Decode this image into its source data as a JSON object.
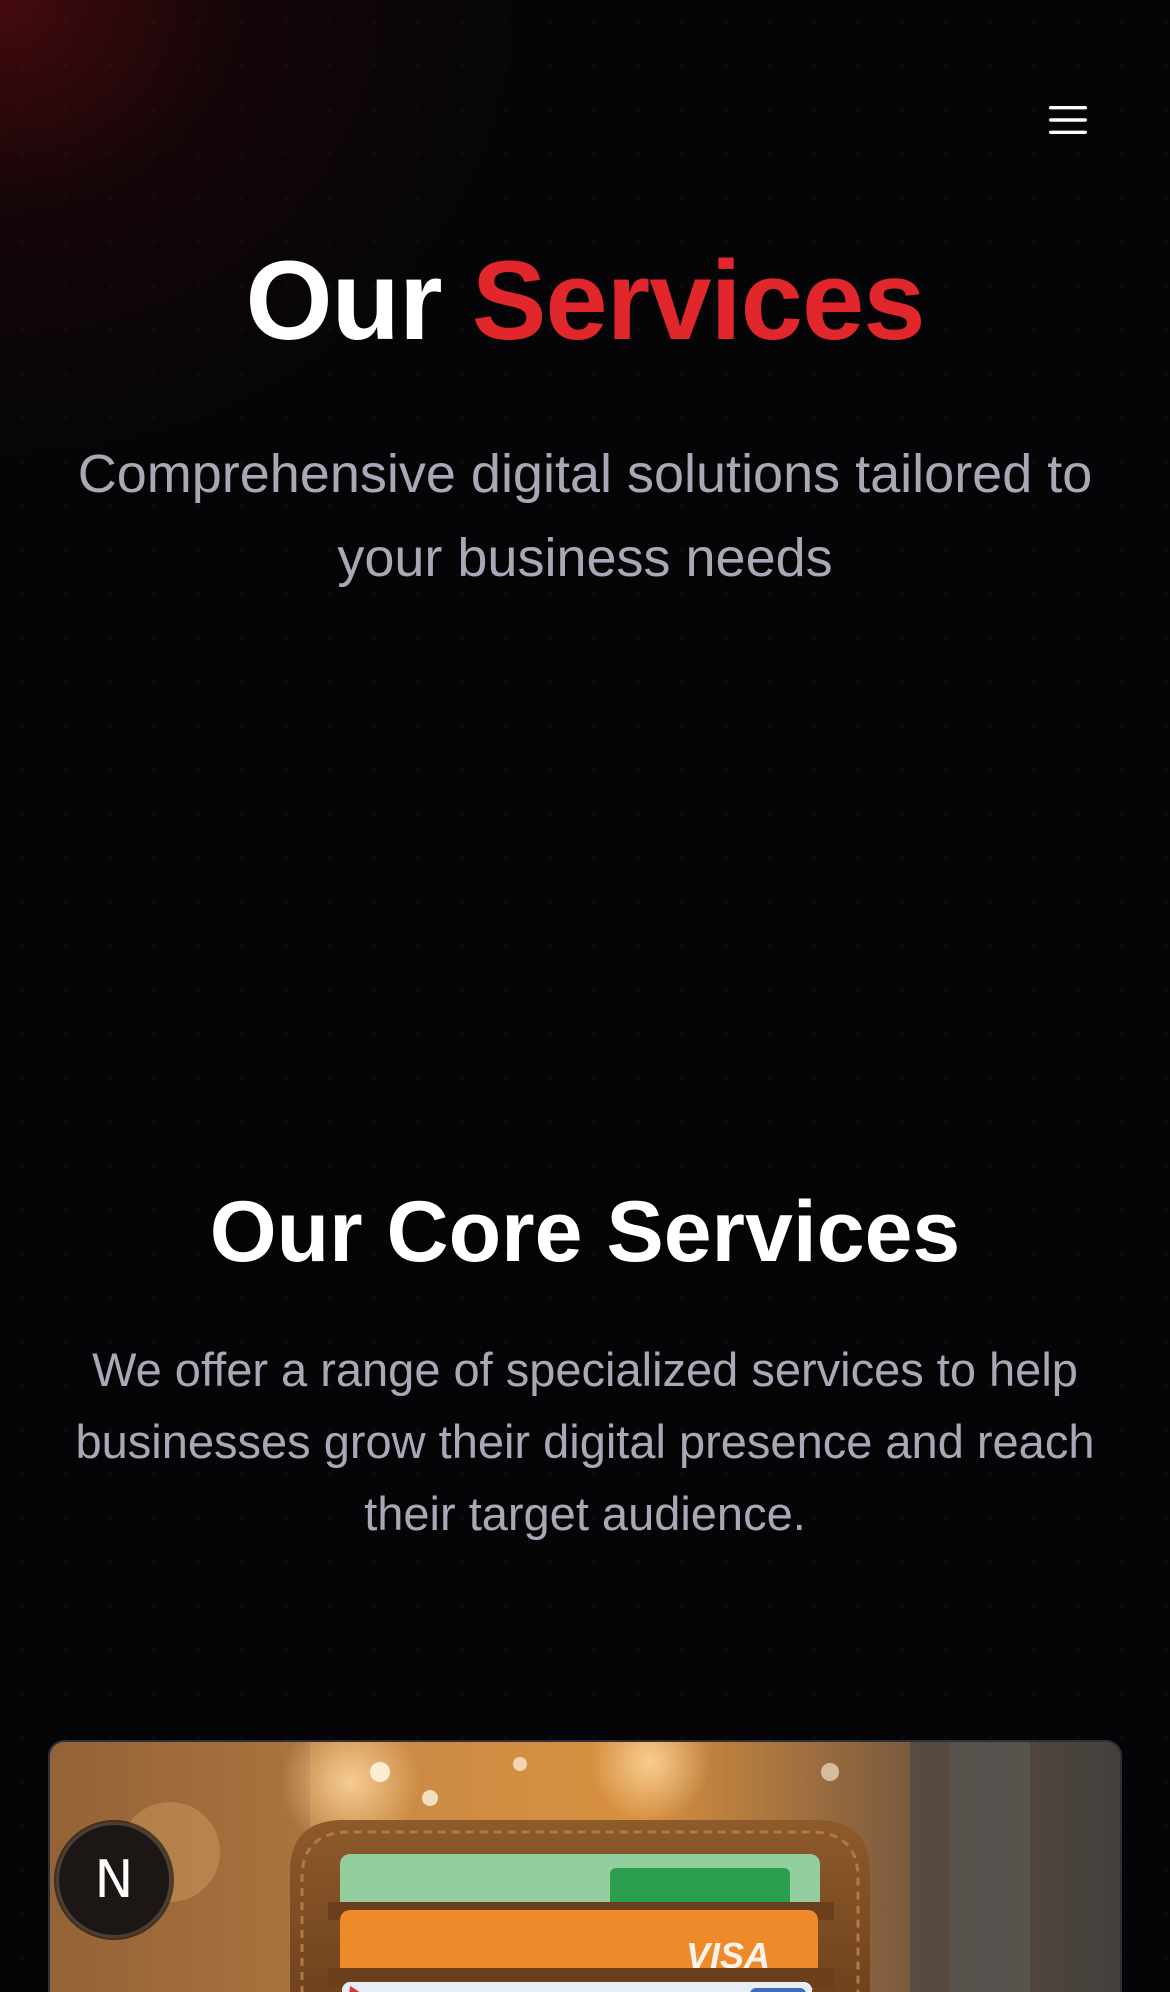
{
  "header": {
    "menu_icon": "hamburger-menu-icon"
  },
  "hero": {
    "title_prefix": "Our",
    "title_accent": "Services",
    "subtitle": "Comprehensive digital solutions tailored to your business needs"
  },
  "core": {
    "title": "Our Core Services",
    "description": "We offer a range of specialized services to help businesses grow their digital presence and reach their target audience."
  },
  "card": {
    "image": "wallet-with-credit-cards-photo",
    "card_text": "VISA"
  },
  "badge": {
    "label": "N"
  },
  "colors": {
    "background": "#050507",
    "accent": "#e1262c",
    "muted_text": "#a8a9b7",
    "card_border": "#2c313c"
  }
}
